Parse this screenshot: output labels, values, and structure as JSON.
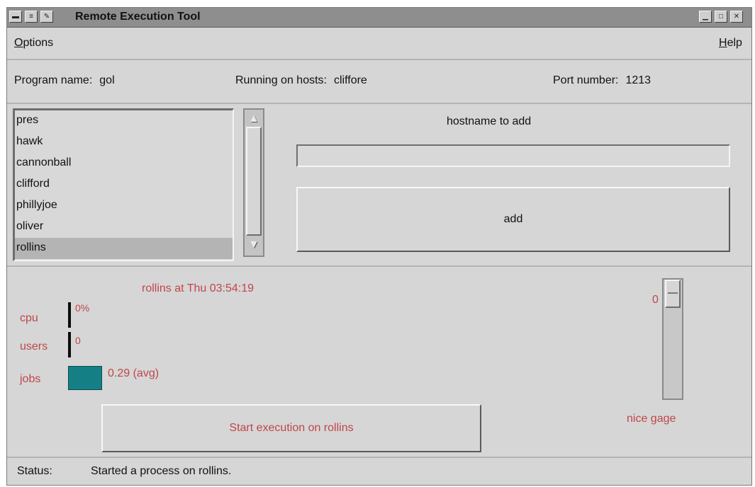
{
  "window": {
    "title": "Remote Execution Tool",
    "title_buttons": [
      "window-menu",
      "minimize",
      "maximize",
      "close"
    ]
  },
  "menu": {
    "options_u": "O",
    "options_rest": "ptions",
    "help_u": "H",
    "help_rest": "elp"
  },
  "info": {
    "program_label": "Program name:",
    "program_value": "gol",
    "hosts_label": "Running on hosts:",
    "hosts_value": "cliffore",
    "port_label": "Port number:",
    "port_value": "1213"
  },
  "hosts": {
    "items": [
      "pres",
      "hawk",
      "cannonball",
      "clifford",
      "phillyjoe",
      "oliver",
      "rollins"
    ],
    "selected": "rollins"
  },
  "add_panel": {
    "label": "hostname to add",
    "input_value": "",
    "add_button": "add"
  },
  "monitor": {
    "host_status": "rollins at Thu 03:54:19",
    "cpu_label": "cpu",
    "cpu_value": "0%",
    "users_label": "users",
    "users_value": "0",
    "jobs_label": "jobs",
    "jobs_value": "0.29 (avg)",
    "start_button": "Start execution on rollins",
    "gauge_value": "0",
    "gauge_level": 0,
    "gauge_label": "nice gage"
  },
  "status": {
    "label": "Status:",
    "text": "Started a process on rollins."
  },
  "colors": {
    "accent_text": "#c0464a",
    "jobs_bar": "#157f86",
    "background": "#d6d6d6"
  }
}
